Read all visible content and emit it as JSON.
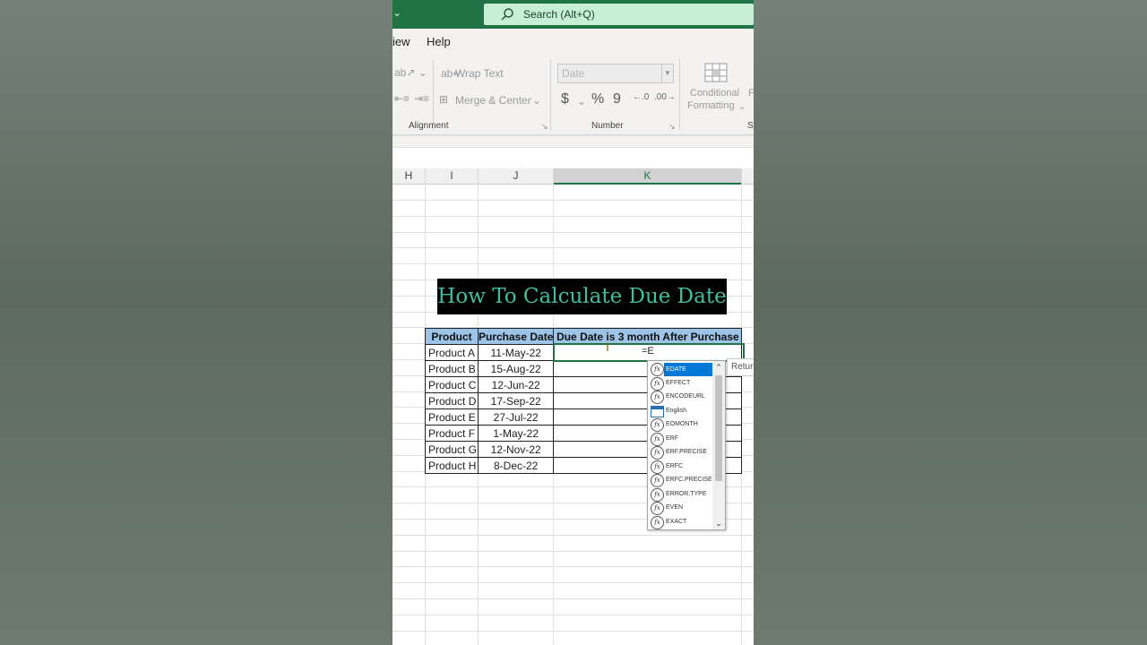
{
  "search": {
    "placeholder": "Search (Alt+Q)"
  },
  "menu": {
    "view_partial": "iew",
    "help": "Help"
  },
  "ribbon": {
    "wrap_text": "Wrap Text",
    "merge_center": "Merge & Center",
    "number_format": "Date",
    "currency_symbol": "$",
    "percent_symbol": "%",
    "comma_symbol": "9",
    "conditional_formatting_line1": "Conditional",
    "conditional_formatting_line2": "Formatting",
    "format_partial": "F",
    "styles_partial": "St",
    "groups": {
      "alignment": "Alignment",
      "number": "Number"
    }
  },
  "columns": [
    "H",
    "I",
    "J",
    "K"
  ],
  "banner": {
    "title": "How To Calculate Due Date"
  },
  "table": {
    "headers": [
      "Product",
      "Purchase Date",
      "Due Date is 3 month After Purchase"
    ],
    "rows": [
      {
        "product": "Product A",
        "date": "11-May-22",
        "due": ""
      },
      {
        "product": "Product B",
        "date": "15-Aug-22",
        "due": ""
      },
      {
        "product": "Product C",
        "date": "12-Jun-22",
        "due": ""
      },
      {
        "product": "Product D",
        "date": "17-Sep-22",
        "due": ""
      },
      {
        "product": "Product E",
        "date": "27-Jul-22",
        "due": ""
      },
      {
        "product": "Product F",
        "date": "1-May-22",
        "due": ""
      },
      {
        "product": "Product G",
        "date": "12-Nov-22",
        "due": ""
      },
      {
        "product": "Product H",
        "date": "8-Dec-22",
        "due": ""
      }
    ]
  },
  "active_cell": {
    "formula": "=E"
  },
  "autocomplete": {
    "items": [
      "EDATE",
      "EFFECT",
      "ENCODEURL",
      "English",
      "EOMONTH",
      "ERF",
      "ERF.PRECISE",
      "ERFC",
      "ERFC.PRECISE",
      "ERROR.TYPE",
      "EVEN",
      "EXACT"
    ],
    "selected": "EDATE",
    "fx_glyph": "fx"
  },
  "tooltip": {
    "text": "Retur"
  },
  "colors": {
    "excel_green": "#217346",
    "header_blue": "#9dc3e6",
    "selection_blue": "#0078d7",
    "banner_text": "#3fbf9f"
  }
}
